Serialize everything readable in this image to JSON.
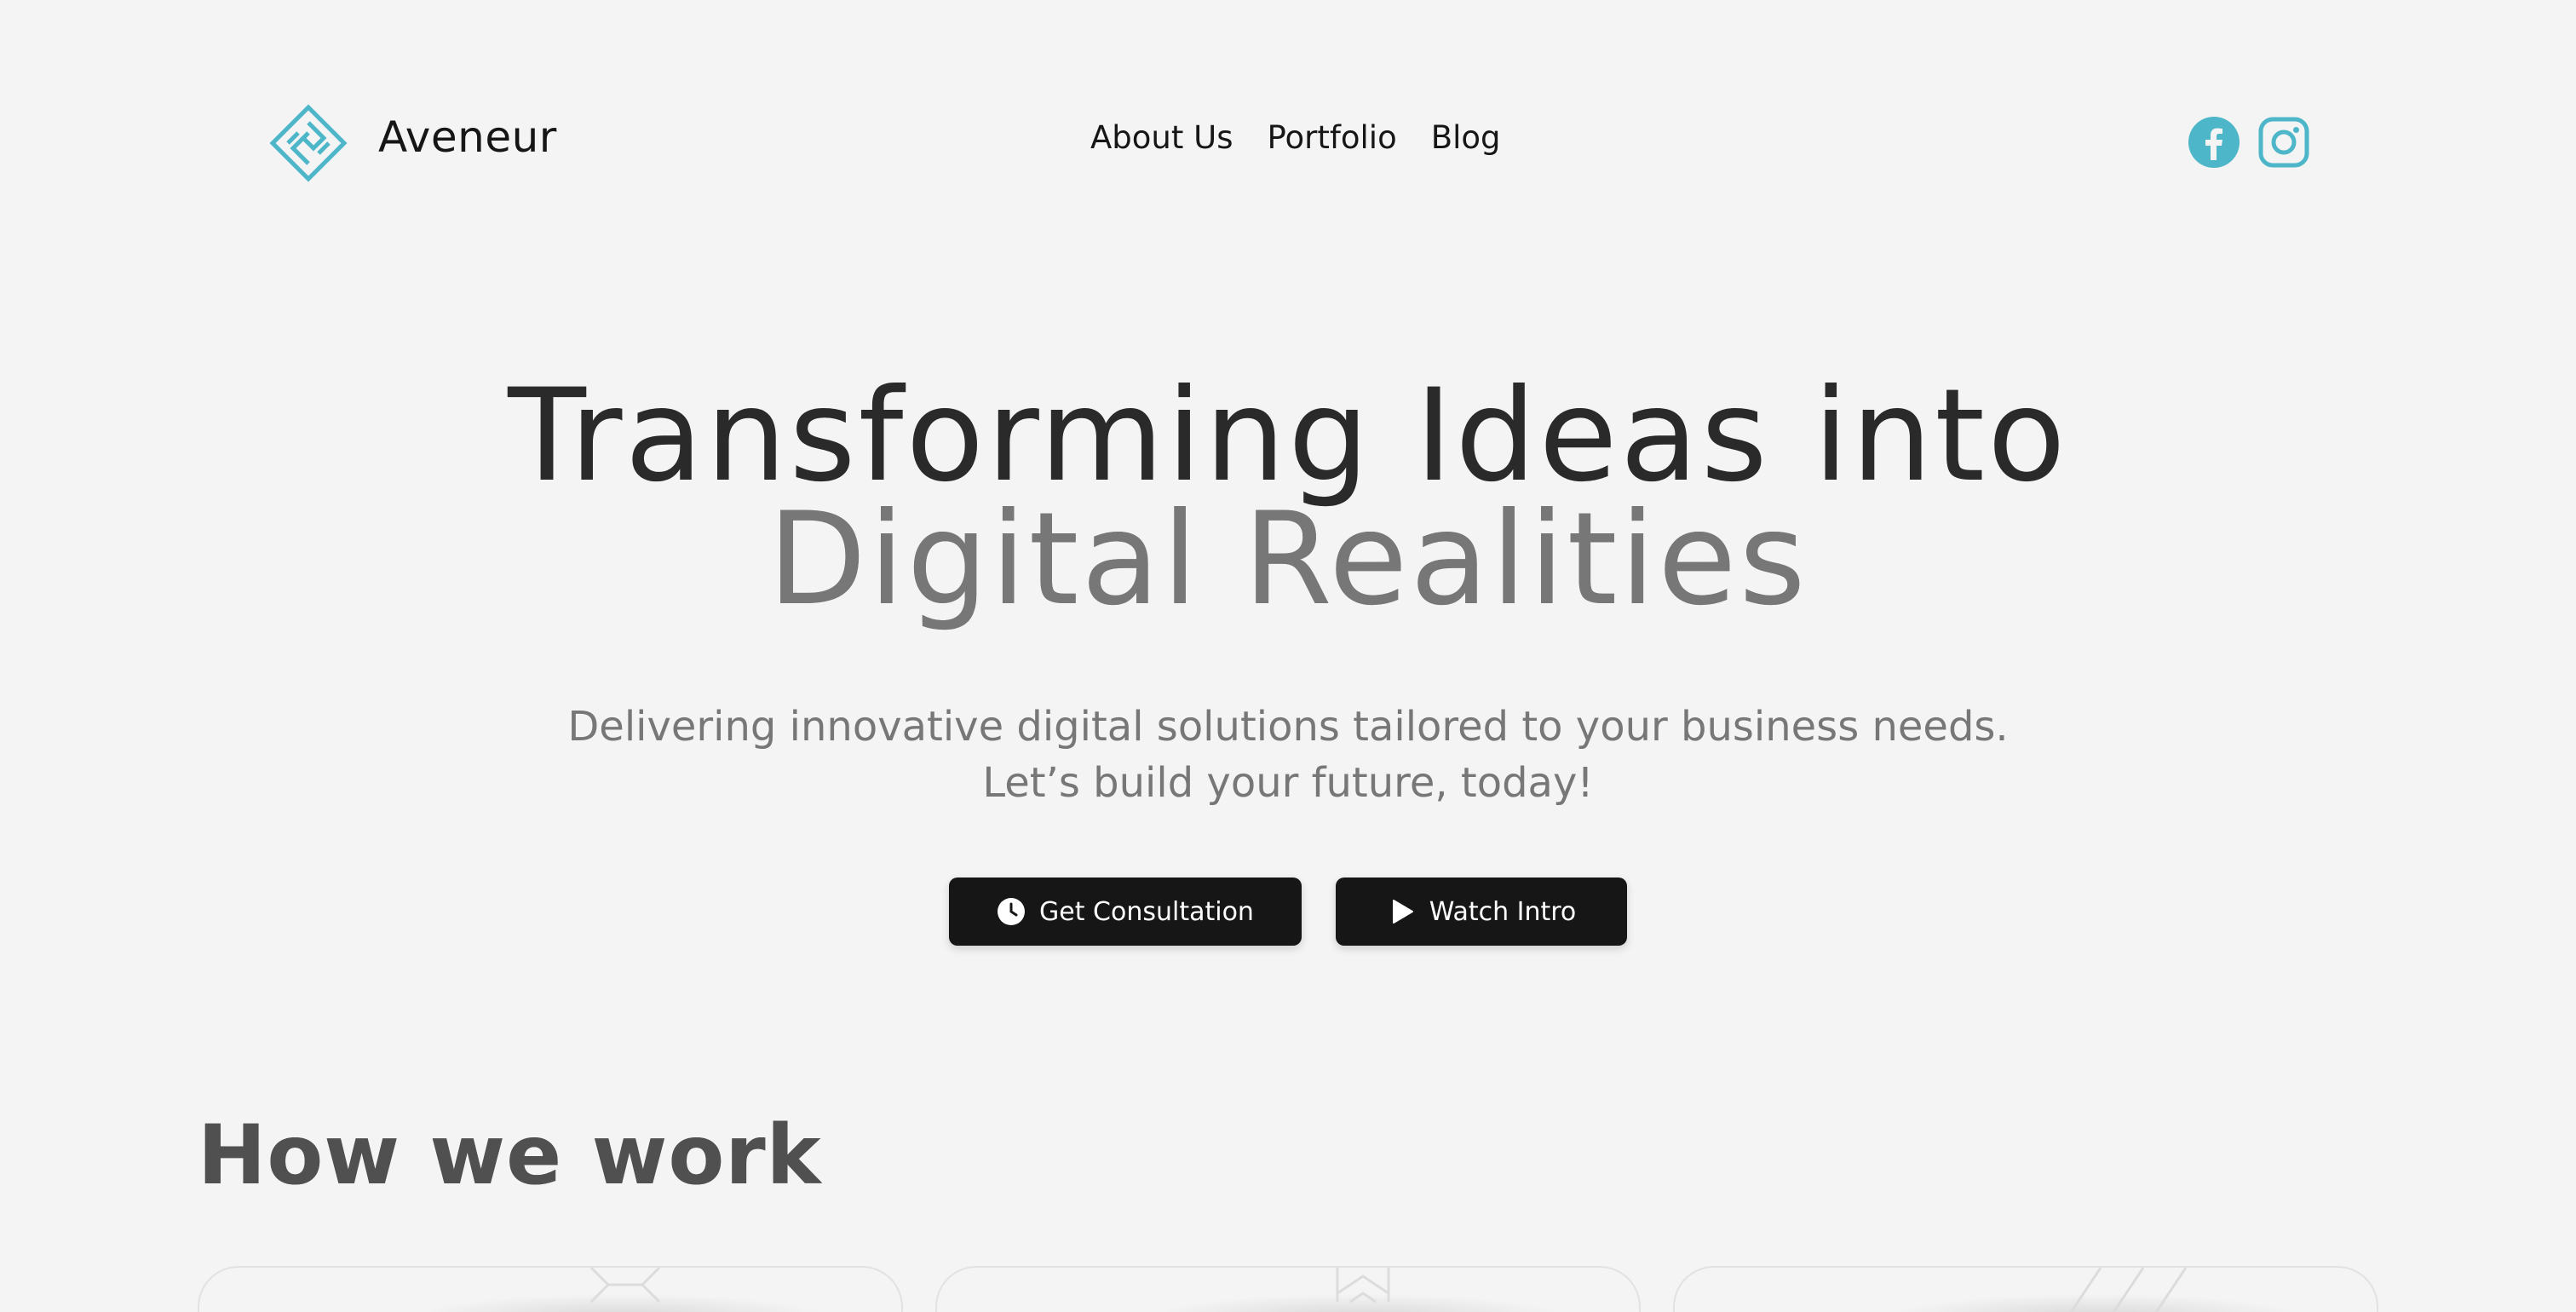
{
  "brand": {
    "name": "Aveneur",
    "logo_icon": "aveneur-logo-icon",
    "accent": "#4db6c8"
  },
  "nav": {
    "items": [
      {
        "label": "About Us"
      },
      {
        "label": "Portfolio"
      },
      {
        "label": "Blog"
      }
    ]
  },
  "social": [
    {
      "icon": "facebook-icon"
    },
    {
      "icon": "instagram-icon"
    }
  ],
  "hero": {
    "title_line1": "Transforming Ideas into",
    "title_line2": "Digital Realities",
    "subtitle_line1": "Delivering innovative digital solutions tailored to your business needs.",
    "subtitle_line2": "Let’s build your future, today!"
  },
  "cta": {
    "primary": {
      "label": "Get Consultation",
      "icon": "clock-icon"
    },
    "secondary": {
      "label": "Watch Intro",
      "icon": "play-icon"
    }
  },
  "how_we_work": {
    "title": "How we work"
  },
  "colors": {
    "background": "#f4f4f4",
    "button": "#161616",
    "text": "#161616",
    "muted": "#777777"
  }
}
